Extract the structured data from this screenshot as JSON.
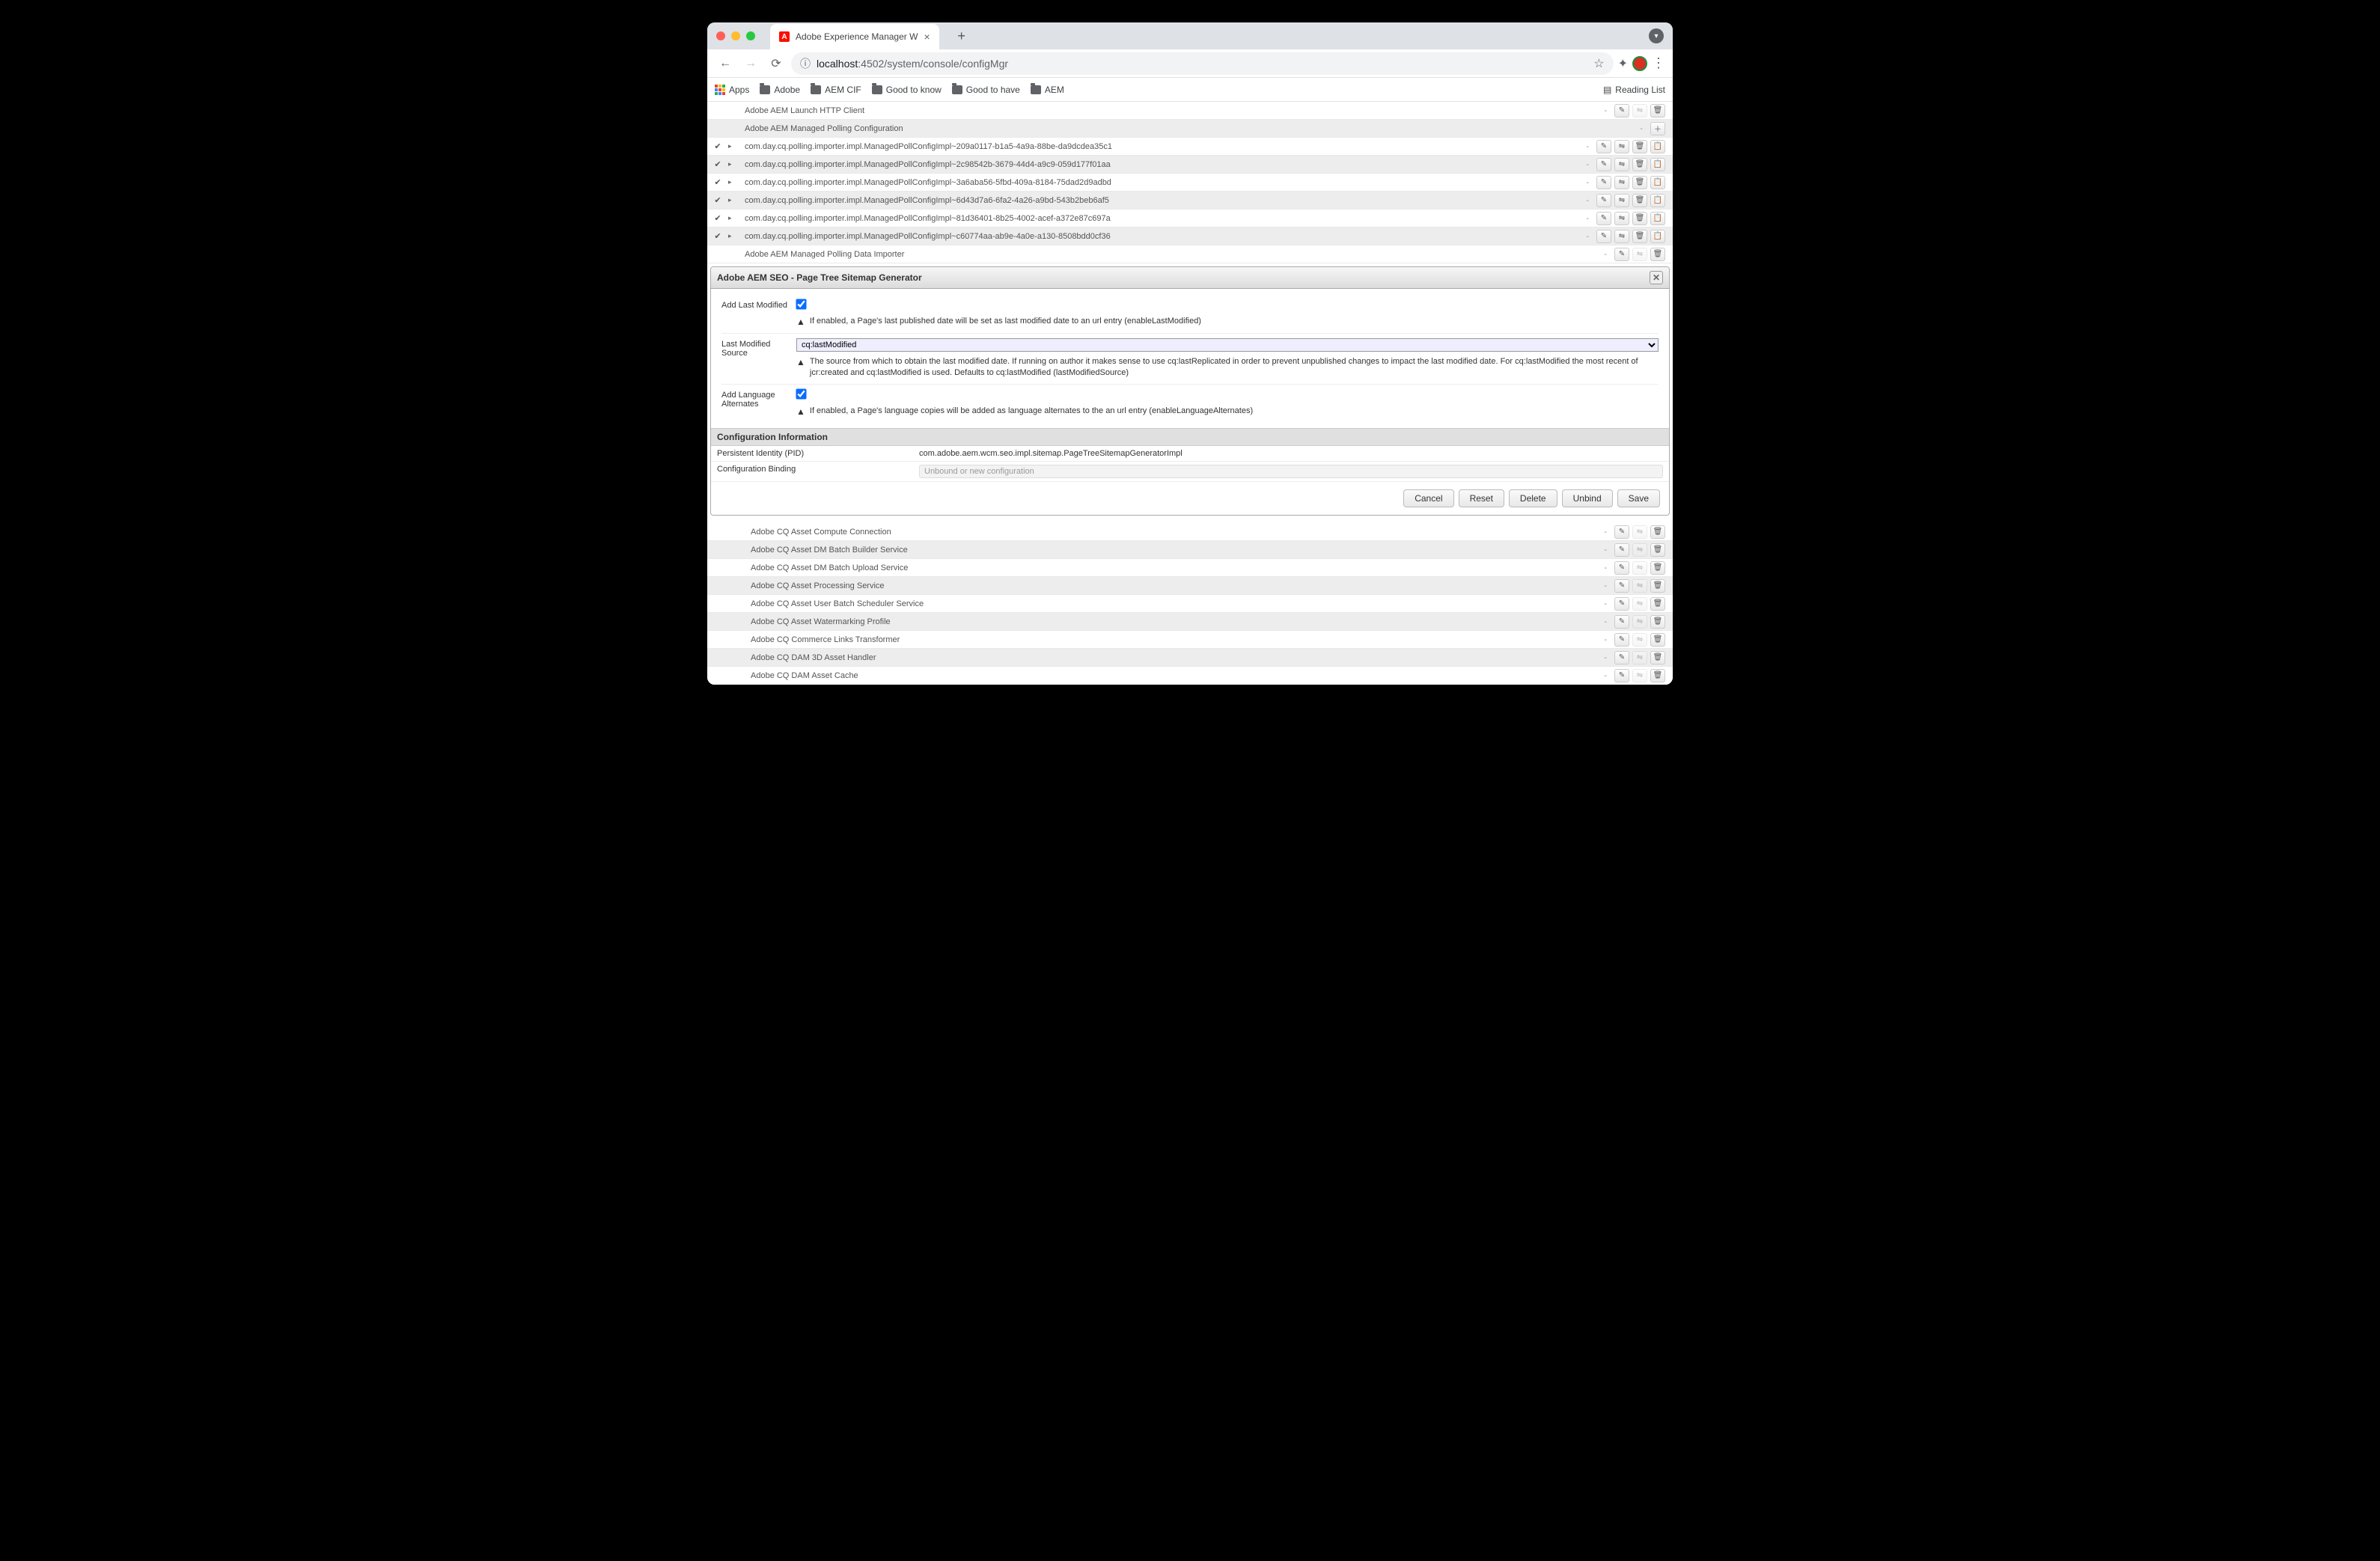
{
  "browser": {
    "tab_title": "Adobe Experience Manager W",
    "url_info": "ⓘ",
    "url_host": "localhost",
    "url_port_path": ":4502/system/console/configMgr",
    "bookmarks": {
      "apps": "Apps",
      "adobe": "Adobe",
      "aem_cif": "AEM CIF",
      "good_to_know": "Good to know",
      "good_to_have": "Good to have",
      "aem": "AEM",
      "reading_list": "Reading List"
    }
  },
  "rows_top": [
    {
      "check": false,
      "arrow": false,
      "label": "Adobe AEM Launch HTTP Client",
      "alt": false,
      "actions": [
        "edit",
        "copy",
        "delete"
      ]
    },
    {
      "check": false,
      "arrow": false,
      "label": "Adobe AEM Managed Polling Configuration",
      "alt": true,
      "actions": [
        "plus"
      ]
    },
    {
      "check": true,
      "arrow": true,
      "label": "com.day.cq.polling.importer.impl.ManagedPollConfigImpl~209a0117-b1a5-4a9a-88be-da9dcdea35c1",
      "alt": false,
      "actions": [
        "edit",
        "copy",
        "delete",
        "clipboard"
      ]
    },
    {
      "check": true,
      "arrow": true,
      "label": "com.day.cq.polling.importer.impl.ManagedPollConfigImpl~2c98542b-3679-44d4-a9c9-059d177f01aa",
      "alt": true,
      "actions": [
        "edit",
        "copy",
        "delete",
        "clipboard"
      ]
    },
    {
      "check": true,
      "arrow": true,
      "label": "com.day.cq.polling.importer.impl.ManagedPollConfigImpl~3a6aba56-5fbd-409a-8184-75dad2d9adbd",
      "alt": false,
      "actions": [
        "edit",
        "copy",
        "delete",
        "clipboard"
      ]
    },
    {
      "check": true,
      "arrow": true,
      "label": "com.day.cq.polling.importer.impl.ManagedPollConfigImpl~6d43d7a6-6fa2-4a26-a9bd-543b2beb6af5",
      "alt": true,
      "actions": [
        "edit",
        "copy",
        "delete",
        "clipboard"
      ]
    },
    {
      "check": true,
      "arrow": true,
      "label": "com.day.cq.polling.importer.impl.ManagedPollConfigImpl~81d36401-8b25-4002-acef-a372e87c697a",
      "alt": false,
      "actions": [
        "edit",
        "copy",
        "delete",
        "clipboard"
      ]
    },
    {
      "check": true,
      "arrow": true,
      "label": "com.day.cq.polling.importer.impl.ManagedPollConfigImpl~c60774aa-ab9e-4a0e-a130-8508bdd0cf36",
      "alt": true,
      "actions": [
        "edit",
        "copy",
        "delete",
        "clipboard"
      ]
    },
    {
      "check": false,
      "arrow": false,
      "label": "Adobe AEM Managed Polling Data Importer",
      "alt": false,
      "actions": [
        "edit",
        "copy",
        "delete"
      ]
    }
  ],
  "dialog": {
    "title": "Adobe AEM SEO - Page Tree Sitemap Generator",
    "fields": {
      "add_last_modified": {
        "label": "Add Last Modified",
        "checked": true,
        "hint": "If enabled, a Page's last published date will be set as last modified date to an url entry (enableLastModified)"
      },
      "last_modified_source": {
        "label": "Last Modified Source",
        "value": "cq:lastModified",
        "hint": "The source from which to obtain the last modified date. If running on author it makes sense to use cq:lastReplicated in order to prevent unpublished changes to impact the last modified date. For cq:lastModified the most recent of jcr:created and cq:lastModified is used. Defaults to cq:lastModified (lastModifiedSource)"
      },
      "add_language_alternates": {
        "label": "Add Language Alternates",
        "checked": true,
        "hint": "If enabled, a Page's language copies will be added as language alternates to the an url entry (enableLanguageAlternates)"
      }
    },
    "config_info_header": "Configuration Information",
    "pid": {
      "label": "Persistent Identity (PID)",
      "value": "com.adobe.aem.wcm.seo.impl.sitemap.PageTreeSitemapGeneratorImpl"
    },
    "binding": {
      "label": "Configuration Binding",
      "value": "Unbound or new configuration"
    },
    "buttons": {
      "cancel": "Cancel",
      "reset": "Reset",
      "delete": "Delete",
      "unbind": "Unbind",
      "save": "Save"
    }
  },
  "rows_bottom": [
    {
      "label": "Adobe CQ Asset Compute Connection",
      "alt": false
    },
    {
      "label": "Adobe CQ Asset DM Batch Builder Service",
      "alt": true
    },
    {
      "label": "Adobe CQ Asset DM Batch Upload Service",
      "alt": false
    },
    {
      "label": "Adobe CQ Asset Processing Service",
      "alt": true
    },
    {
      "label": "Adobe CQ Asset User Batch Scheduler Service",
      "alt": false
    },
    {
      "label": "Adobe CQ Asset Watermarking Profile",
      "alt": true
    },
    {
      "label": "Adobe CQ Commerce Links Transformer",
      "alt": false
    },
    {
      "label": "Adobe CQ DAM 3D Asset Handler",
      "alt": true
    },
    {
      "label": "Adobe CQ DAM Asset Cache",
      "alt": false
    }
  ]
}
